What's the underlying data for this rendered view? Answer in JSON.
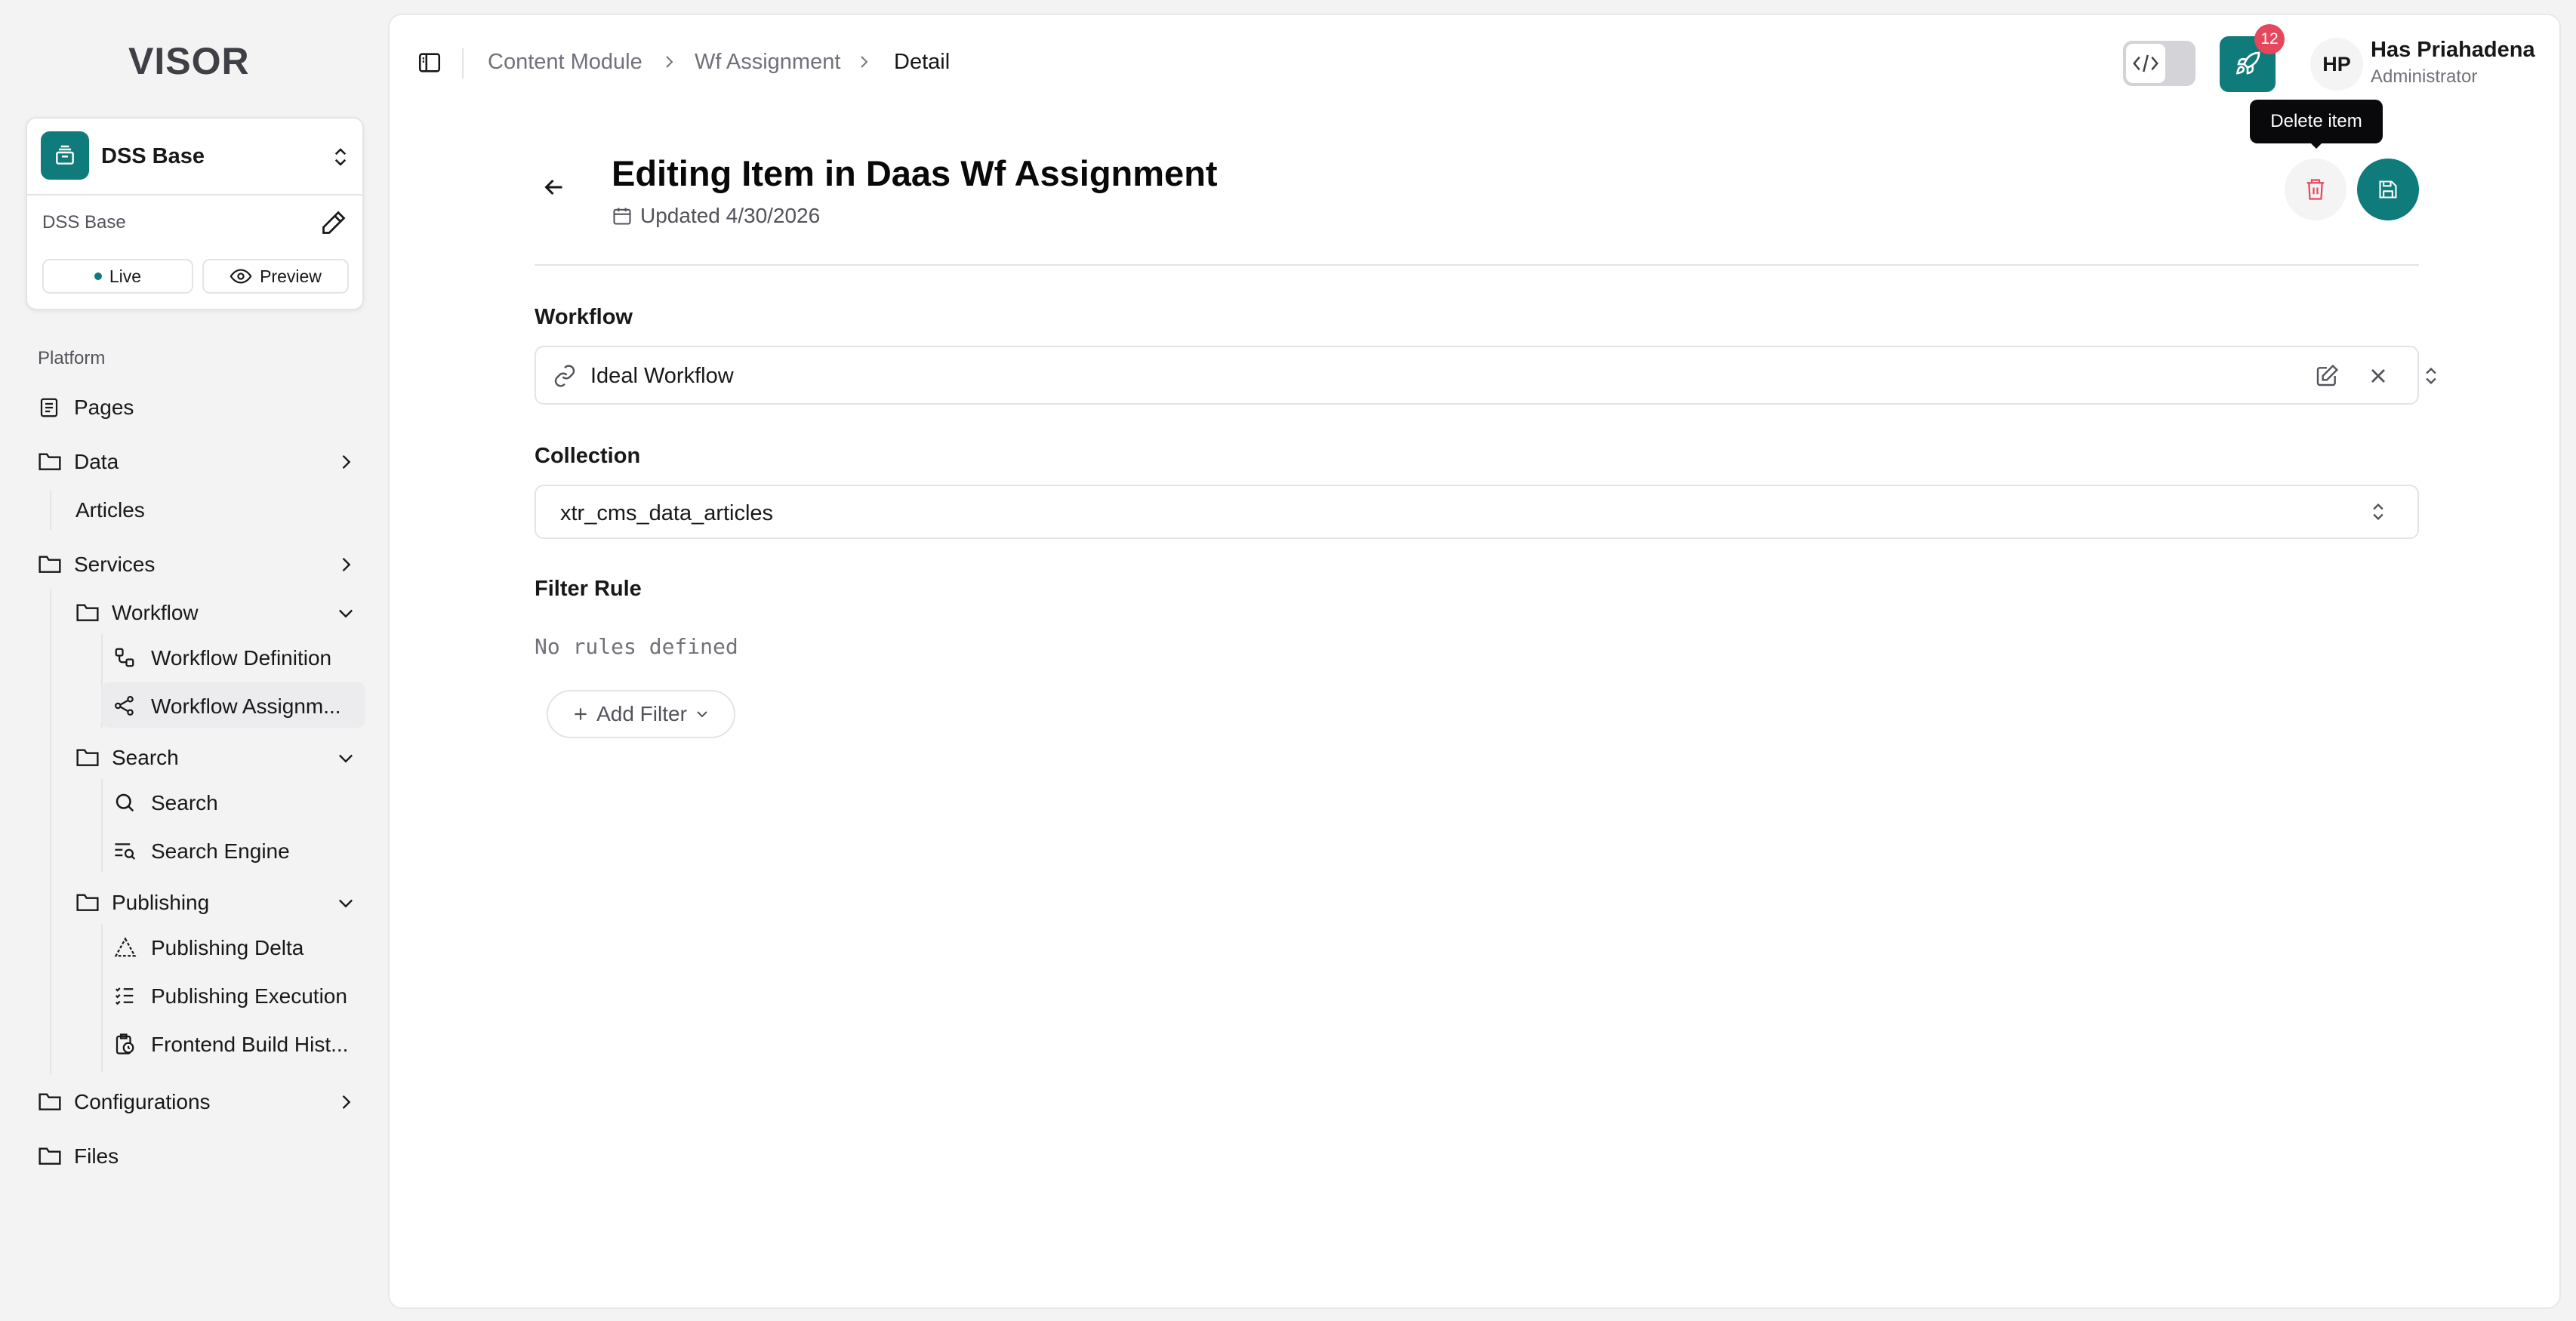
{
  "app": {
    "logo_text": "VISOR"
  },
  "project": {
    "name": "DSS Base",
    "subtitle": "DSS Base",
    "live_label": "Live",
    "preview_label": "Preview"
  },
  "sidebar": {
    "section_label": "Platform",
    "items": {
      "pages": "Pages",
      "data": "Data",
      "articles": "Articles",
      "services": "Services",
      "workflow": "Workflow",
      "workflow_definition": "Workflow Definition",
      "workflow_assignment": "Workflow Assignm...",
      "search_group": "Search",
      "search": "Search",
      "search_engine": "Search Engine",
      "publishing": "Publishing",
      "publishing_delta": "Publishing Delta",
      "publishing_execution": "Publishing Execution",
      "frontend_build": "Frontend Build Hist...",
      "configurations": "Configurations",
      "files": "Files"
    }
  },
  "breadcrumb": [
    "Content Module",
    "Wf Assignment",
    "Detail"
  ],
  "topbar": {
    "deploy_badge": "12",
    "user_initials": "HP",
    "user_name": "Has Priahadena",
    "user_role": "Administrator",
    "tooltip": "Delete item"
  },
  "page": {
    "title": "Editing Item in Daas Wf Assignment",
    "updated": "Updated 4/30/2026"
  },
  "form": {
    "workflow_label": "Workflow",
    "workflow_value": "Ideal Workflow",
    "collection_label": "Collection",
    "collection_value": "xtr_cms_data_articles",
    "filter_label": "Filter Rule",
    "no_rules": "No rules defined",
    "add_filter": "Add Filter"
  },
  "colors": {
    "accent": "#0f7b7b",
    "danger": "#e5485d",
    "badge": "#e5485d"
  }
}
